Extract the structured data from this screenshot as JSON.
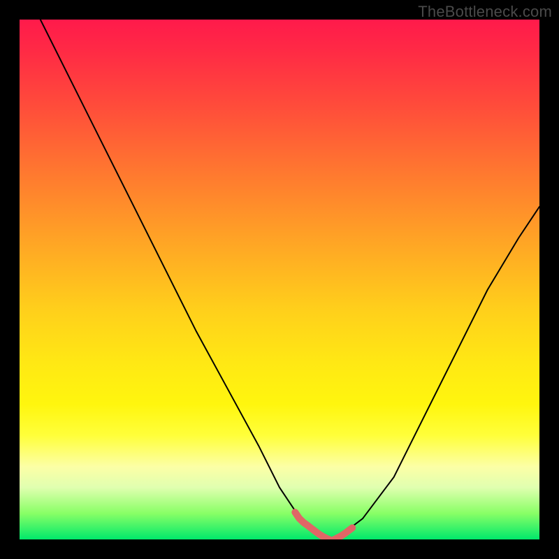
{
  "watermark": {
    "text": "TheBottleneck.com"
  },
  "chart_data": {
    "type": "line",
    "title": "",
    "xlabel": "",
    "ylabel": "",
    "xlim": [
      0,
      100
    ],
    "ylim": [
      0,
      100
    ],
    "grid": false,
    "legend": false,
    "series": [
      {
        "name": "bottleneck-curve",
        "x": [
          4,
          10,
          16,
          22,
          28,
          34,
          40,
          46,
          50,
          54,
          58,
          60,
          62,
          66,
          72,
          78,
          84,
          90,
          96,
          100
        ],
        "y": [
          100,
          88,
          76,
          64,
          52,
          40,
          29,
          18,
          10,
          4,
          1,
          0,
          1,
          4,
          12,
          24,
          36,
          48,
          58,
          64
        ]
      }
    ],
    "annotations": [
      {
        "name": "optimal-band",
        "x_range": [
          53,
          64
        ],
        "style": "thick-pink-underline"
      }
    ],
    "background_gradient": {
      "stops": [
        {
          "pos": 0.0,
          "color": "#ff1a4b"
        },
        {
          "pos": 0.3,
          "color": "#ff7a2f"
        },
        {
          "pos": 0.56,
          "color": "#ffd01b"
        },
        {
          "pos": 0.8,
          "color": "#ffff3a"
        },
        {
          "pos": 0.95,
          "color": "#88ff66"
        },
        {
          "pos": 1.0,
          "color": "#00e86b"
        }
      ]
    }
  }
}
